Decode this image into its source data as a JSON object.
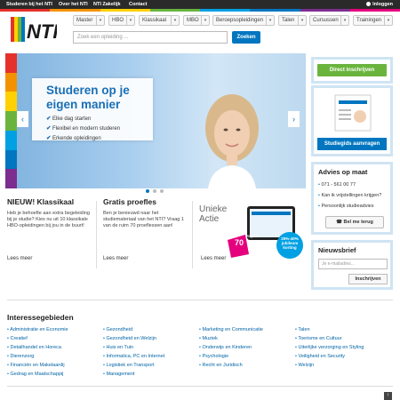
{
  "topbar": {
    "links": [
      "Studeren bij het NTI",
      "Over het NTI",
      "NTI Zakelijk",
      "Contact"
    ],
    "login": "Inloggen"
  },
  "brand": {
    "logo_text": "NTI",
    "colors": [
      "#e4312b",
      "#f39200",
      "#ffd100",
      "#6ab43e",
      "#00a0e3",
      "#0076c0",
      "#7c2d8f",
      "#e5007d"
    ]
  },
  "nav": [
    "Master",
    "HBO",
    "Klassikaal",
    "MBO",
    "Beroepsopleidingen",
    "Talen",
    "Cursussen",
    "Trainingen"
  ],
  "search": {
    "placeholder": "Zoek een opleiding ...",
    "button": "Zoeken"
  },
  "hero": {
    "title": "Studeren op je eigen manier",
    "bullets": [
      "Elke dag starten",
      "Flexibel en modern studeren",
      "Erkende opleidingen"
    ],
    "prev": "‹",
    "next": "›"
  },
  "sidebar": {
    "enroll": "Direct inschrijven",
    "brochure": "Studiegids aanvragen",
    "advice_title": "Advies op maat",
    "phone": "071 - 561 00 77",
    "link1": "Kan ik vrijstellingen krijgen?",
    "link2": "Persoonlijk studieadvies",
    "call": "Bel me terug",
    "news_title": "Nieuwsbrief",
    "news_placeholder": "Je e-mailadres...",
    "news_button": "Inschrijven"
  },
  "promos": [
    {
      "title": "NIEUW! Klassikaal",
      "text": "Heb je behoefte aan extra begeleiding bij je studie? Kies nu uit 10 klassikale HBO-opleidingen bij jou in de buurt!",
      "more": "Lees meer"
    },
    {
      "title": "Gratis proefles",
      "text": "Ben je benieuwd naar het studiemateriaal van het NTI? Vraag 1 van de ruim 70 proeflessen aan!",
      "more": "Lees meer"
    },
    {
      "title": "Unieke Actie",
      "badge_top": "70 jaar",
      "badge_num": "70",
      "badge_text": "25%-40% jubileum korting",
      "more": "Lees meer"
    }
  ],
  "interests": {
    "title": "Interessegebieden",
    "col1": [
      "Administratie en Economie",
      "Creatief",
      "Detailhandel en Horeca",
      "Dierenzorg",
      "Financiën en Makelaardij",
      "Gedrag en Maatschappij"
    ],
    "col2": [
      "Gezondheid",
      "Gezondheid en Welzijn",
      "Huis en Tuin",
      "Informatica, PC en Internet",
      "Logistiek en Transport",
      "Management"
    ],
    "col3": [
      "Marketing en Communicatie",
      "Muziek",
      "Onderwijs en Kinderen",
      "Psychologie",
      "Recht en Juridisch"
    ],
    "col4": [
      "Talen",
      "Toerisme en Cultuur",
      "Uiterlijke verzorging en Styling",
      "Veiligheid en Security",
      "Welzijn"
    ]
  },
  "bottom_badge": "↑"
}
